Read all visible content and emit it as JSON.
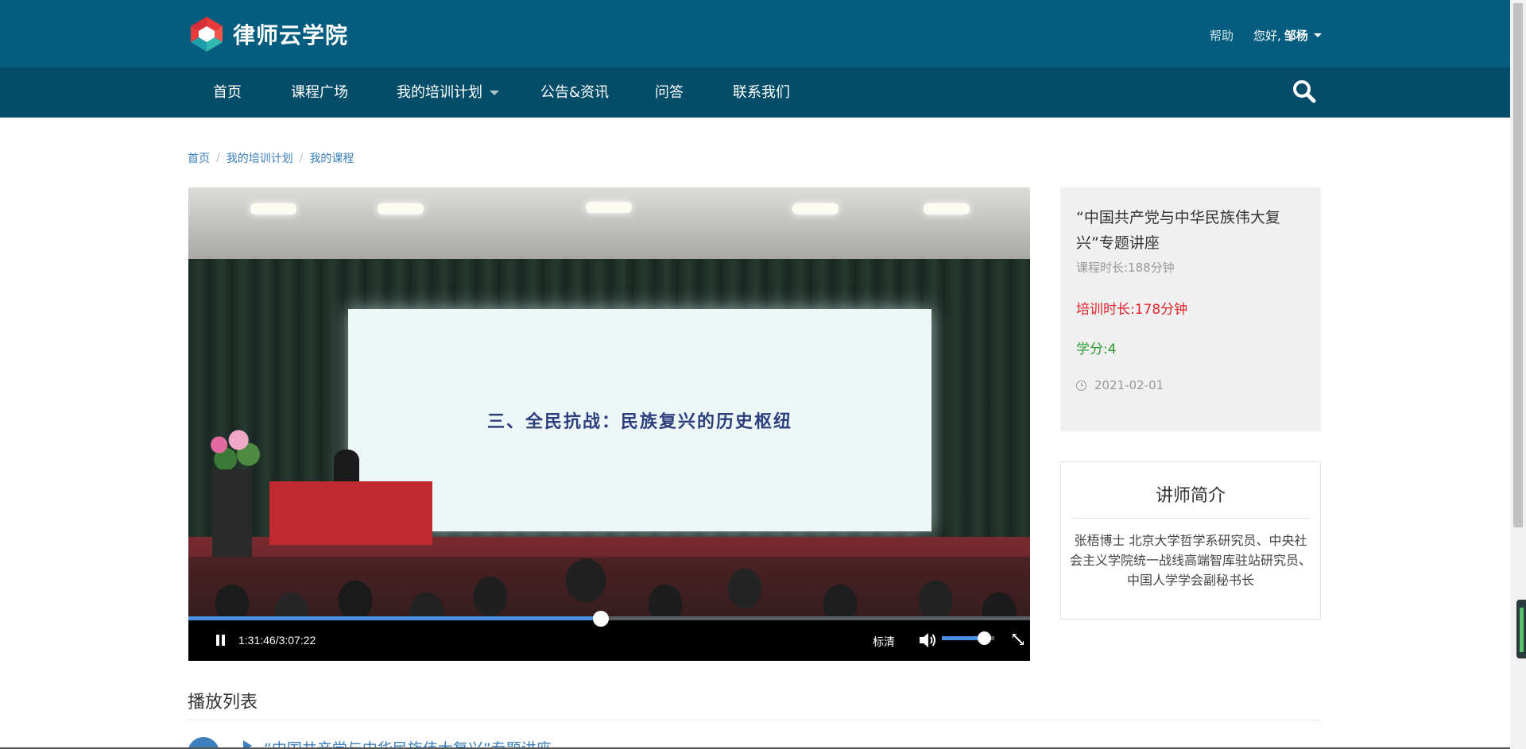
{
  "header": {
    "logo_text": "律师云学院",
    "help": "帮助",
    "greeting": "您好,",
    "username": "邹杨"
  },
  "nav": {
    "items": [
      "首页",
      "课程广场",
      "我的培训计划",
      "公告&资讯",
      "问答",
      "联系我们"
    ]
  },
  "breadcrumb": [
    "首页",
    "我的培训计划",
    "我的课程"
  ],
  "video": {
    "slide_text": "三、全民抗战：民族复兴的历史枢纽",
    "time_display": "1:31:46/3:07:22",
    "progress": 0.49,
    "quality": "标清",
    "volume": 0.8
  },
  "course": {
    "title": "“中国共产党与中华民族伟大复兴”专题讲座",
    "duration": "课程时长:188分钟",
    "training_time": "培训时长:178分钟",
    "credit": "学分:4",
    "date": "2021-02-01"
  },
  "lecturer": {
    "heading": "讲师简介",
    "bio": "张梧博士 北京大学哲学系研究员、中央社会主义学院统一战线高端智库驻站研究员、中国人学学会副秘书长"
  },
  "playlist": {
    "title": "播放列表",
    "items": [
      "“中国共产党与中华民族伟大复兴”专题讲座"
    ]
  },
  "colors": {
    "header_bg": "#045d7f",
    "nav_bg": "#034d69",
    "link": "#3b7fbd",
    "training_red": "#e3222a",
    "credit_green": "#2d9c32",
    "progress_blue": "#4a90e2"
  }
}
